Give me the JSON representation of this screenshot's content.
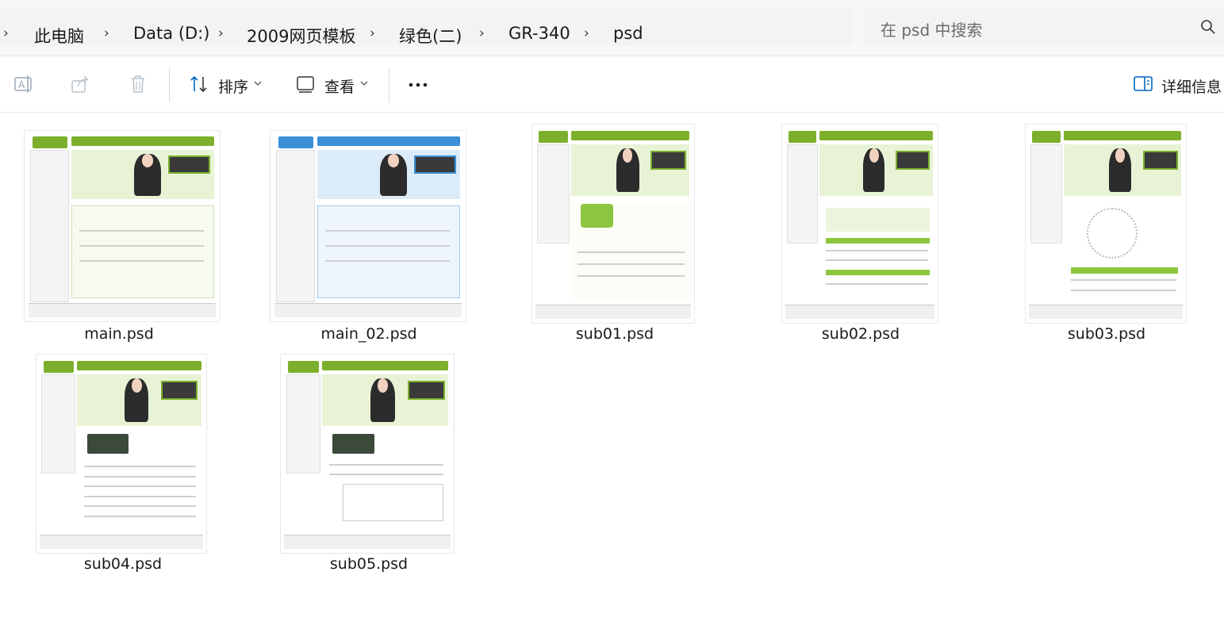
{
  "breadcrumb": {
    "items": [
      "此电脑",
      "Data (D:)",
      "2009网页模板",
      "绿色(二)",
      "GR-340",
      "psd"
    ]
  },
  "search": {
    "placeholder": "在 psd 中搜索"
  },
  "toolbar": {
    "sort_label": "排序",
    "view_label": "查看",
    "details_label": "详细信息"
  },
  "files": [
    {
      "name": "main.psd",
      "accent": "#7cb02c"
    },
    {
      "name": "main_02.psd",
      "accent": "#3a8fd6"
    },
    {
      "name": "sub01.psd",
      "accent": "#7cb02c"
    },
    {
      "name": "sub02.psd",
      "accent": "#7cb02c"
    },
    {
      "name": "sub03.psd",
      "accent": "#7cb02c"
    },
    {
      "name": "sub04.psd",
      "accent": "#7cb02c"
    },
    {
      "name": "sub05.psd",
      "accent": "#7cb02c"
    }
  ],
  "colors": {
    "accent_green": "#7cb02c",
    "accent_blue": "#3a8fd6",
    "icon_blue": "#0067c0"
  },
  "icons": {
    "rename": "rename-icon",
    "share": "share-icon",
    "delete": "delete-icon",
    "sort": "sort-icon",
    "view": "view-icon",
    "more": "more-icon",
    "details": "details-pane-icon",
    "search": "search-icon"
  }
}
